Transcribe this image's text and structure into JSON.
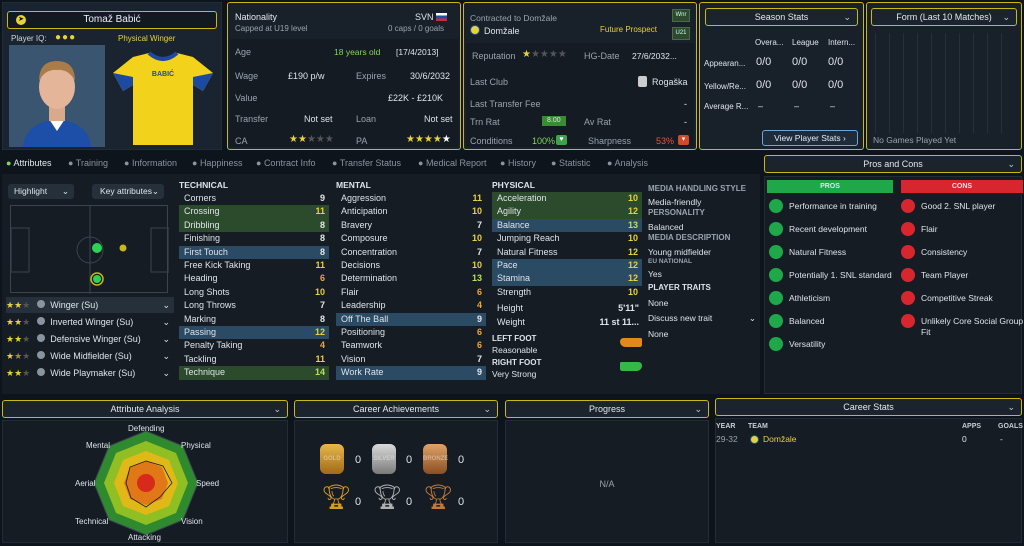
{
  "player": {
    "name": "Tomaž Babić",
    "iq_label": "Player IQ:",
    "position": "Physical Winger",
    "shirt_name": "BABIĆ"
  },
  "bio": {
    "nationality_label": "Nationality",
    "nationality": "SVN",
    "caps_note": "Capped at U19 level",
    "caps": "0 caps / 0 goals",
    "age_label": "Age",
    "age": "18 years old",
    "dob": "[17/4/2013]",
    "wage_label": "Wage",
    "wage": "£190 p/w",
    "expires_label": "Expires",
    "expires": "30/6/2032",
    "value_label": "Value",
    "value": "£22K - £210K",
    "transfer_label": "Transfer",
    "transfer": "Not set",
    "loan_label": "Loan",
    "loan": "Not set",
    "ca_label": "CA",
    "pa_label": "PA"
  },
  "contract": {
    "contracted_label": "Contracted to Domžale",
    "club": "Domžale",
    "future": "Future Prospect",
    "wnr": "Wnr",
    "u21": "U21",
    "reputation_label": "Reputation",
    "hg_label": "HG-Date",
    "hg": "27/6/2032...",
    "lastclub_label": "Last Club",
    "lastclub": "Rogaška",
    "fee_label": "Last Transfer Fee",
    "fee": "-",
    "trn_label": "Trn Rat",
    "trn": "8.00",
    "avrat_label": "Av Rat",
    "avrat": "-",
    "cond_label": "Conditions",
    "cond": "100%",
    "sharp_label": "Sharpness",
    "sharp": "53%"
  },
  "season": {
    "header": "Season Stats",
    "cols": [
      "Overa...",
      "League",
      "Intern..."
    ],
    "rows": [
      {
        "label": "Appearan...",
        "vals": [
          "0/0",
          "0/0",
          "0/0"
        ]
      },
      {
        "label": "Yellow/Re...",
        "vals": [
          "0/0",
          "0/0",
          "0/0"
        ]
      },
      {
        "label": "Average R...",
        "vals": [
          "–",
          "–",
          "–"
        ]
      }
    ],
    "button": "View Player Stats"
  },
  "form": {
    "header": "Form (Last 10 Matches)",
    "empty": "No Games Played Yet"
  },
  "tabs": [
    "Attributes",
    "Training",
    "Information",
    "Happiness",
    "Contract Info",
    "Transfer Status",
    "Medical Report",
    "History",
    "Statistic",
    "Analysis"
  ],
  "controls": {
    "highlight": "Highlight",
    "key": "Key attributes"
  },
  "roles": [
    {
      "name": "Winger (Su)",
      "stars": 2
    },
    {
      "name": "Inverted Winger (Su)",
      "stars": 2
    },
    {
      "name": "Defensive Winger (Su)",
      "stars": 2
    },
    {
      "name": "Wide Midfielder (Su)",
      "stars": 1.5
    },
    {
      "name": "Wide Playmaker (Su)",
      "stars": 2
    }
  ],
  "technical": {
    "header": "TECHNICAL",
    "items": [
      {
        "n": "Corners",
        "v": "9"
      },
      {
        "n": "Crossing",
        "v": "11"
      },
      {
        "n": "Dribbling",
        "v": "8"
      },
      {
        "n": "Finishing",
        "v": "8"
      },
      {
        "n": "First Touch",
        "v": "8"
      },
      {
        "n": "Free Kick Taking",
        "v": "11"
      },
      {
        "n": "Heading",
        "v": "6"
      },
      {
        "n": "Long Shots",
        "v": "10"
      },
      {
        "n": "Long Throws",
        "v": "7"
      },
      {
        "n": "Marking",
        "v": "8"
      },
      {
        "n": "Passing",
        "v": "12"
      },
      {
        "n": "Penalty Taking",
        "v": "4"
      },
      {
        "n": "Tackling",
        "v": "11"
      },
      {
        "n": "Technique",
        "v": "14"
      }
    ]
  },
  "mental": {
    "header": "MENTAL",
    "items": [
      {
        "n": "Aggression",
        "v": "11"
      },
      {
        "n": "Anticipation",
        "v": "10"
      },
      {
        "n": "Bravery",
        "v": "7"
      },
      {
        "n": "Composure",
        "v": "10"
      },
      {
        "n": "Concentration",
        "v": "7"
      },
      {
        "n": "Decisions",
        "v": "10"
      },
      {
        "n": "Determination",
        "v": "13"
      },
      {
        "n": "Flair",
        "v": "6"
      },
      {
        "n": "Leadership",
        "v": "4"
      },
      {
        "n": "Off The Ball",
        "v": "9"
      },
      {
        "n": "Positioning",
        "v": "6"
      },
      {
        "n": "Teamwork",
        "v": "6"
      },
      {
        "n": "Vision",
        "v": "7"
      },
      {
        "n": "Work Rate",
        "v": "9"
      }
    ]
  },
  "physical": {
    "header": "PHYSICAL",
    "items": [
      {
        "n": "Acceleration",
        "v": "10"
      },
      {
        "n": "Agility",
        "v": "12"
      },
      {
        "n": "Balance",
        "v": "13"
      },
      {
        "n": "Jumping Reach",
        "v": "10"
      },
      {
        "n": "Natural Fitness",
        "v": "12"
      },
      {
        "n": "Pace",
        "v": "12"
      },
      {
        "n": "Stamina",
        "v": "12"
      },
      {
        "n": "Strength",
        "v": "10"
      }
    ],
    "height_label": "Height",
    "height": "5'11\"",
    "weight_label": "Weight",
    "weight": "11 st 11...",
    "left_label": "LEFT FOOT",
    "left": "Reasonable",
    "right_label": "RIGHT FOOT",
    "right": "Very Strong"
  },
  "media": {
    "style_label": "MEDIA HANDLING STYLE",
    "style": "Media-friendly",
    "pers_label": "PERSONALITY",
    "pers": "Balanced",
    "desc_label": "MEDIA DESCRIPTION",
    "desc": "Young midfielder",
    "eu_label": "EU NATIONAL",
    "eu": "Yes",
    "traits_label": "PLAYER TRAITS",
    "traits": "None",
    "discuss": "Discuss new trait",
    "discuss_val": "None"
  },
  "proscons": {
    "header": "Pros and Cons",
    "pros_label": "PROS",
    "cons_label": "CONS",
    "pros": [
      "Performance in training",
      "Recent development",
      "Natural Fitness",
      "Potentially 1. SNL standard",
      "Athleticism",
      "Balanced",
      "Versatility"
    ],
    "cons": [
      "Good 2. SNL player",
      "Flair",
      "Consistency",
      "Team Player",
      "Competitive Streak",
      "Unlikely Core Social Group Fit"
    ]
  },
  "analysis": {
    "header": "Attribute Analysis",
    "labels": [
      "Defending",
      "Physical",
      "Speed",
      "Vision",
      "Attacking",
      "Technical",
      "Aerial",
      "Mental"
    ]
  },
  "achievements": {
    "header": "Career Achievements",
    "medals": [
      {
        "label": "GOLD",
        "count": "0"
      },
      {
        "label": "SILVER",
        "count": "0"
      },
      {
        "label": "BRONZE",
        "count": "0"
      }
    ],
    "trophies": [
      "0",
      "0",
      "0"
    ]
  },
  "progress": {
    "header": "Progress",
    "empty": "N/A"
  },
  "career": {
    "header": "Career Stats",
    "cols": [
      "YEAR",
      "TEAM",
      "APPS",
      "GOALS"
    ],
    "rows": [
      {
        "year": "29-32",
        "team": "Domžale",
        "apps": "0",
        "goals": "-"
      }
    ]
  }
}
